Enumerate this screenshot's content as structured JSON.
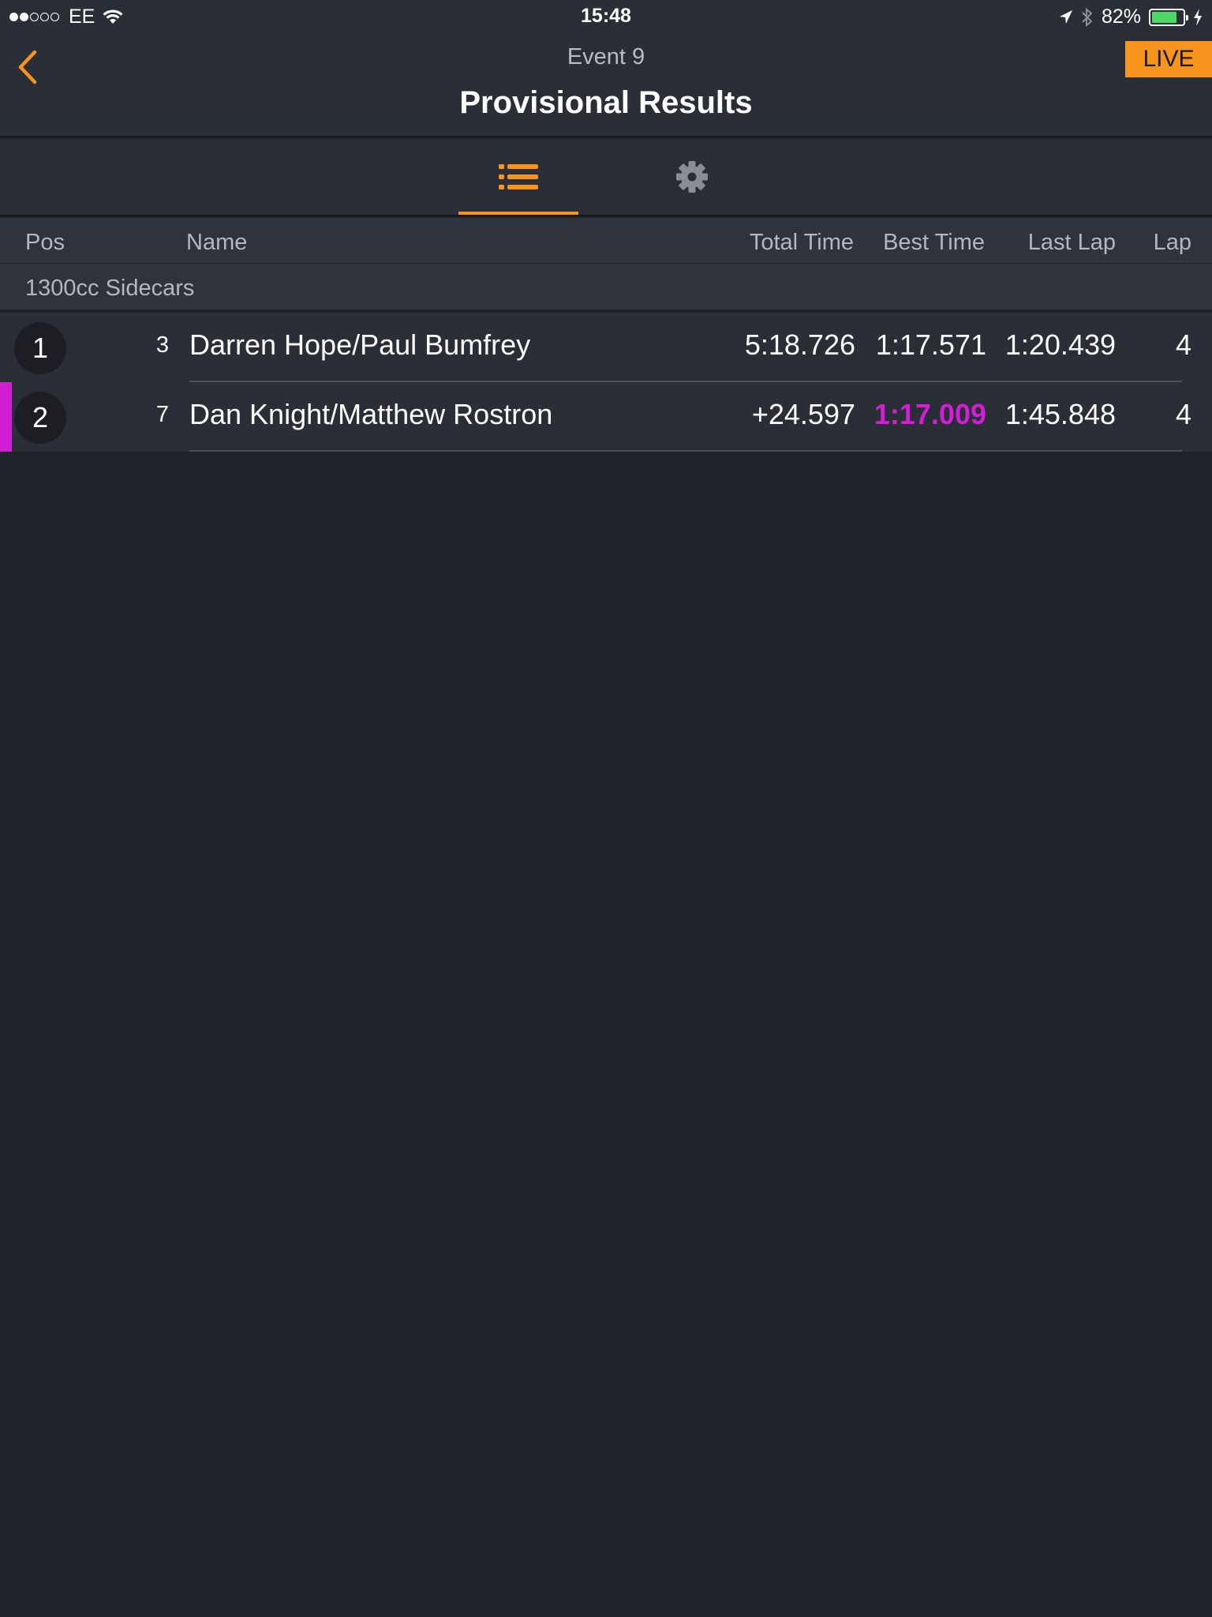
{
  "status_bar": {
    "carrier": "EE",
    "time": "15:48",
    "battery": "82%",
    "battery_level": 0.82,
    "signal_bars_filled": 2,
    "signal_bars_total": 5
  },
  "header": {
    "subtitle": "Event 9",
    "title": "Provisional Results",
    "live_label": "LIVE"
  },
  "tabs": [
    {
      "icon": "list-icon",
      "active": true
    },
    {
      "icon": "gear-icon",
      "active": false
    }
  ],
  "table": {
    "columns": {
      "pos": "Pos",
      "name": "Name",
      "total_time": "Total Time",
      "best_time": "Best Time",
      "last_lap": "Last Lap",
      "lap": "Lap"
    },
    "group": "1300cc Sidecars",
    "rows": [
      {
        "pos": "1",
        "number": "3",
        "name": "Darren Hope/Paul Bumfrey",
        "total_time": "5:18.726",
        "best_time": "1:17.571",
        "last_lap": "1:20.439",
        "lap": "4",
        "fastest": false
      },
      {
        "pos": "2",
        "number": "7",
        "name": "Dan Knight/Matthew Rostron",
        "total_time": "+24.597",
        "best_time": "1:17.009",
        "last_lap": "1:45.848",
        "lap": "4",
        "fastest": true
      }
    ]
  },
  "colors": {
    "accent": "#f7941d",
    "fastest_lap": "#d21fd5",
    "background": "#20232b"
  }
}
